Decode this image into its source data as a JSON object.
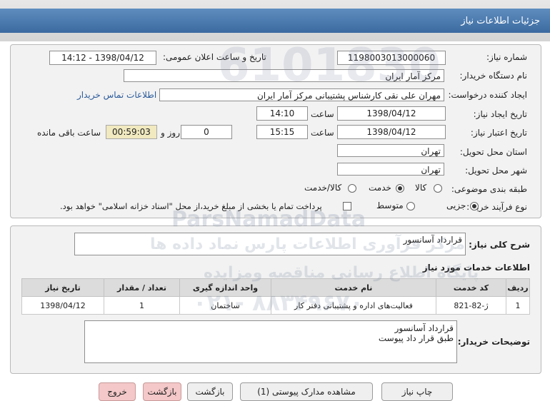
{
  "header": {
    "title": "جزئیات اطلاعات نیاز"
  },
  "form": {
    "need_number_label": "شماره نیاز:",
    "need_number": "1198003013000060",
    "announce_label": "تاریخ و ساعت اعلان عمومی:",
    "announce_value": "1398/04/12 - 14:12",
    "buyer_org_label": "نام دستگاه خریدار:",
    "buyer_org": "مرکز آمار ایران",
    "creator_label": "ایجاد کننده درخواست:",
    "creator": "مهران  علی نقی کارشناس پشتیبانی مرکز آمار ایران",
    "contact_link": "اطلاعات تماس خریدار",
    "created_date_label": "تاریخ ایجاد نیاز:",
    "created_date": "1398/04/12",
    "time_label": "ساعت",
    "created_time": "14:10",
    "valid_date_label": "تاریخ اعتبار نیاز:",
    "valid_date": "1398/04/12",
    "valid_time": "15:15",
    "days": "0",
    "days_label": "روز و",
    "remaining": "00:59:03",
    "remaining_label": "ساعت باقی مانده",
    "province_label": "استان محل تحویل:",
    "province": "تهران",
    "city_label": "شهر محل تحویل:",
    "city": "تهران",
    "category_label": "طبقه بندی موضوعی:",
    "category_options": [
      "کالا",
      "خدمت",
      "کالا/خدمت"
    ],
    "category_selected": "خدمت",
    "process_label": "نوع فرآیند خرید :",
    "process_options": [
      "جزیی",
      "متوسط"
    ],
    "process_selected": "جزیی",
    "payment_note": "پرداخت تمام یا بخشی از مبلغ خرید،از محل \"اسناد خزانه اسلامی\" خواهد بود."
  },
  "summary": {
    "label": "شرح کلی نیاز:",
    "value": "قرارداد آسانسور"
  },
  "services": {
    "title": "اطلاعات خدمات مورد نیاز",
    "columns": [
      "ردیف",
      "کد خدمت",
      "نام خدمت",
      "واحد اندازه گیری",
      "تعداد / مقدار",
      "تاریخ نیاز"
    ],
    "rows": [
      [
        "1",
        "ژ-82-821",
        "فعالیت‌های اداره و پشتیبانی دفتر کار",
        "ساختمان",
        "1",
        "1398/04/12"
      ]
    ]
  },
  "notes": {
    "label": "توضیحات خریدار:",
    "line1": "قرارداد آسانسور",
    "line2": "طبق قرار داد پیوست"
  },
  "buttons": {
    "print": "چاپ نیاز",
    "attachments": "مشاهده مدارک پیوستی (1)",
    "back": "بازگشت",
    "return": "بازگشت",
    "exit": "خروج"
  },
  "watermark": {
    "line1": "ParsNamadData",
    "line2": "مرکز فرآوری اطلاعات پارس نماد داده ها",
    "line3": "پایگاه اطلاع رسانی مناقصه ومزایده",
    "line4": "۰۲۱- ۸۸۳۴۹۶۷۰",
    "bignum": "6101830"
  },
  "colors": {
    "header_bg": "#3b6aa0",
    "panel_bg": "#f2f2f2",
    "remaining_bg": "#f1eac0",
    "link": "#2b5b9a"
  }
}
